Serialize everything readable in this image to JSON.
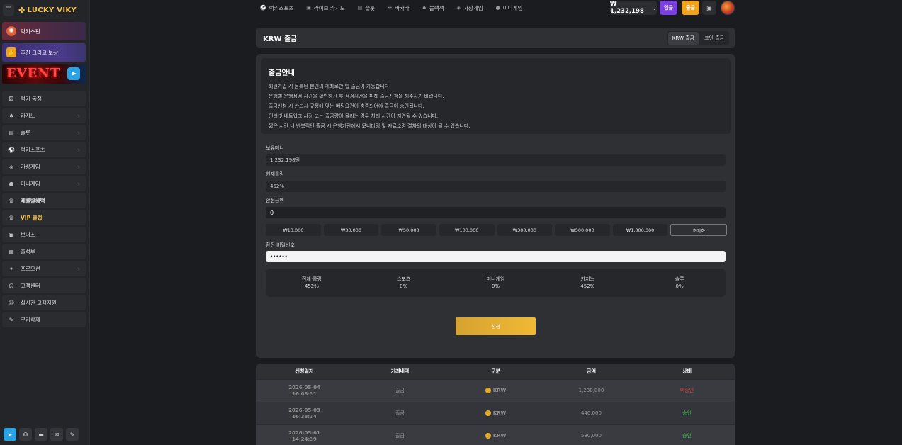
{
  "brand": {
    "name": "LUCKY VIKY"
  },
  "sidebar": {
    "promos": [
      {
        "label": "럭키스핀"
      },
      {
        "label": "추천 그리고 보상"
      }
    ],
    "event_banner": "EVENT",
    "items": [
      {
        "label": "럭키 독점",
        "icon": "dice-icon",
        "chevron": false
      },
      {
        "label": "카지노",
        "icon": "cards-icon",
        "chevron": true
      },
      {
        "label": "슬롯",
        "icon": "slot-icon",
        "chevron": true
      },
      {
        "label": "럭키스포츠",
        "icon": "ball-icon",
        "chevron": true
      },
      {
        "label": "가상게임",
        "icon": "gamepad-icon",
        "chevron": true
      },
      {
        "label": "미니게임",
        "icon": "mini-icon",
        "chevron": true
      },
      {
        "label": "레벨별혜택",
        "icon": "crown-icon",
        "chevron": false
      },
      {
        "label": "VIP 클럽",
        "icon": "crown-icon",
        "chevron": false
      },
      {
        "label": "보너스",
        "icon": "gift-icon",
        "chevron": false
      },
      {
        "label": "출석부",
        "icon": "calendar-icon",
        "chevron": false
      },
      {
        "label": "프로모션",
        "icon": "promo-icon",
        "chevron": true
      },
      {
        "label": "고객센터",
        "icon": "headset-icon",
        "chevron": false
      },
      {
        "label": "실시간 고객지원",
        "icon": "support-icon",
        "chevron": false
      },
      {
        "label": "쿠키삭제",
        "icon": "broom-icon",
        "chevron": false
      }
    ]
  },
  "topnav": [
    {
      "label": "럭키스포츠"
    },
    {
      "label": "라이브 카지노"
    },
    {
      "label": "슬롯"
    },
    {
      "label": "바카라"
    },
    {
      "label": "블랙잭"
    },
    {
      "label": "가상게임"
    },
    {
      "label": "미니게임"
    }
  ],
  "header": {
    "balance": "₩ 1,232,198",
    "deposit_label": "입금",
    "withdraw_label": "출금"
  },
  "page": {
    "title": "KRW 출금",
    "tabs": [
      "KRW 출금",
      "코인 출금"
    ]
  },
  "info": {
    "title": "출금안내",
    "lines": [
      "회원가입 시 등록된 본인의 계좌로만 입 출금이 가능합니다.",
      "은행별 은행점검 시간을 확인하신 후 점검시간을 피해 출금신청을 해주시기 바랍니다.",
      "출금신청 시 반드시 규정에 맞는 베팅요건이 충족되어야 출금이 승인됩니다.",
      "인터넷 네트워크 사정 또는 출금량이 몰리는 경우 처리 시간이 지연될 수 있습니다.",
      "짧은 시간 내 반복적인 출금 시 은행기관에서 모니터링 및 자료소명 절차의 대상이 될 수 있습니다."
    ]
  },
  "form": {
    "balance_label": "보유머니",
    "balance_value": "1,232,198원",
    "rolling_label": "현재롤링",
    "rolling_value": "452%",
    "amount_label": "환전금액",
    "amount_value": "0",
    "quick_amounts": [
      "₩10,000",
      "₩30,000",
      "₩50,000",
      "₩100,000",
      "₩300,000",
      "₩500,000",
      "₩1,000,000"
    ],
    "reset_label": "초기화",
    "password_label": "환전 비밀번호",
    "password_value": "••••••"
  },
  "rolling_summary": [
    {
      "label": "전체 롤링",
      "value": "452%"
    },
    {
      "label": "스포츠",
      "value": "0%"
    },
    {
      "label": "미니게임",
      "value": "0%"
    },
    {
      "label": "카지노",
      "value": "452%"
    },
    {
      "label": "슬롯",
      "value": "0%"
    }
  ],
  "submit_label": "신청",
  "history": {
    "columns": [
      "신청일자",
      "거래내역",
      "구분",
      "금액",
      "상태"
    ],
    "rows": [
      {
        "date": "2026-05-04",
        "time": "16:08:31",
        "type": "출금",
        "currency": "KRW",
        "amount": "1,230,000",
        "status": "미승인",
        "status_color": "#e04444"
      },
      {
        "date": "2026-05-03",
        "time": "16:38:34",
        "type": "출금",
        "currency": "KRW",
        "amount": "440,000",
        "status": "승인",
        "status_color": "#3bc24a"
      },
      {
        "date": "2026-05-01",
        "time": "14:24:39",
        "type": "출금",
        "currency": "KRW",
        "amount": "530,000",
        "status": "승인",
        "status_color": "#3bc24a"
      }
    ]
  }
}
